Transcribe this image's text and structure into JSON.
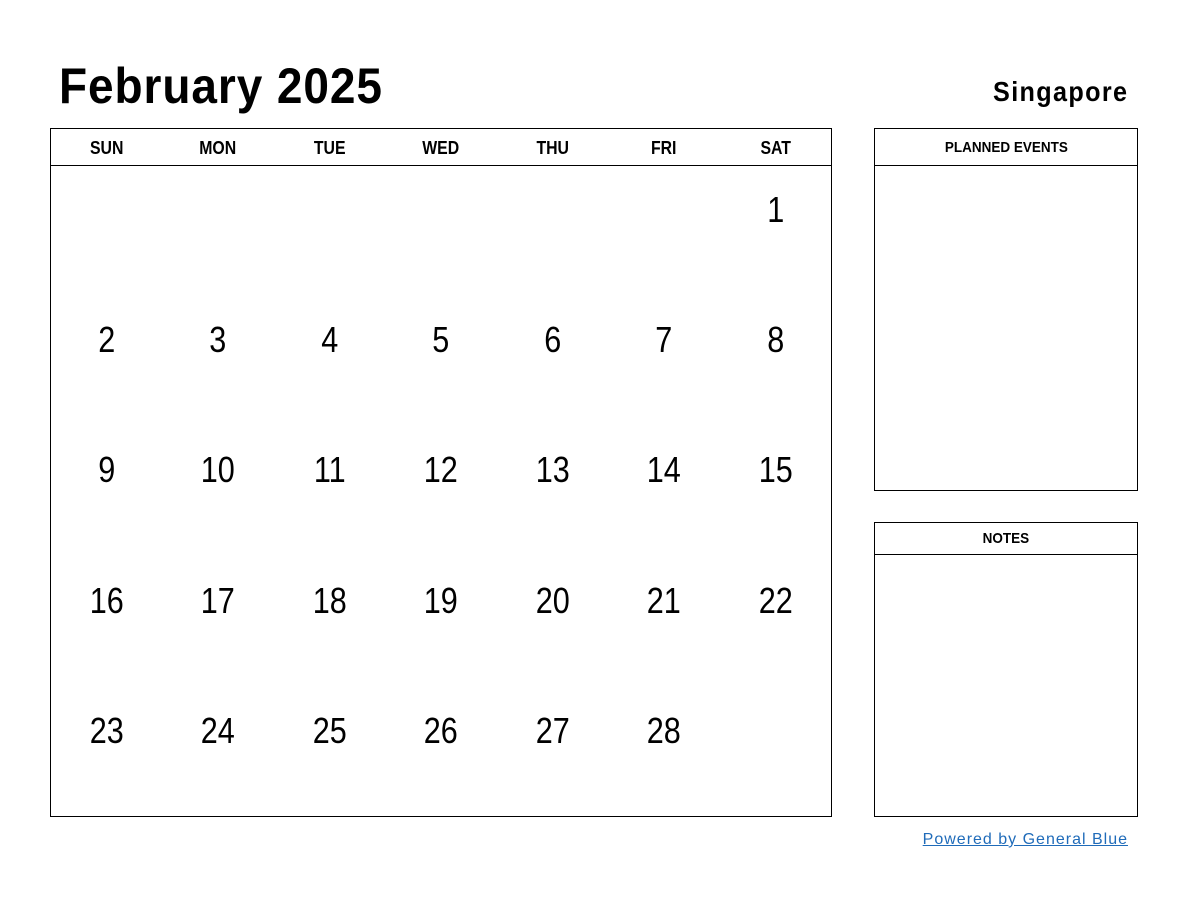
{
  "header": {
    "title": "February 2025",
    "country": "Singapore"
  },
  "calendar": {
    "weekdays": [
      "SUN",
      "MON",
      "TUE",
      "WED",
      "THU",
      "FRI",
      "SAT"
    ],
    "weeks": [
      [
        "",
        "",
        "",
        "",
        "",
        "",
        "1"
      ],
      [
        "2",
        "3",
        "4",
        "5",
        "6",
        "7",
        "8"
      ],
      [
        "9",
        "10",
        "11",
        "12",
        "13",
        "14",
        "15"
      ],
      [
        "16",
        "17",
        "18",
        "19",
        "20",
        "21",
        "22"
      ],
      [
        "23",
        "24",
        "25",
        "26",
        "27",
        "28",
        ""
      ]
    ]
  },
  "side_panels": {
    "planned_events_label": "PLANNED EVENTS",
    "notes_label": "NOTES"
  },
  "footer": {
    "link_text": "Powered by General Blue",
    "link_color": "#1f6bb9"
  }
}
